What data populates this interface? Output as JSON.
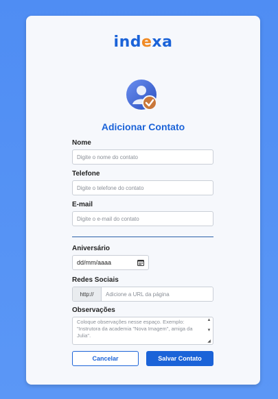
{
  "brand": {
    "logo_part1": "ind",
    "logo_accent": "e",
    "logo_part2": "xa"
  },
  "form": {
    "title": "Adicionar Contato",
    "name": {
      "label": "Nome",
      "placeholder": "Digite o nome do contato"
    },
    "phone": {
      "label": "Telefone",
      "placeholder": "Digite o telefone do contato"
    },
    "email": {
      "label": "E-mail",
      "placeholder": "Digite o e-mail do contato"
    },
    "birthday": {
      "label": "Aniversário",
      "value": "dd/mm/aaaa"
    },
    "social": {
      "label": "Redes Sociais",
      "prefix": "http://",
      "placeholder": "Adicione a URL da página"
    },
    "notes": {
      "label": "Observações",
      "placeholder": "Coloque observações nesse espaço. Exemplo: \"Instrutora da academia \"Nova Imagem\", amiga da Julia\"."
    },
    "cancel_label": "Cancelar",
    "save_label": "Salvar Contato"
  },
  "icons": {
    "avatar": "user-avatar-icon",
    "check": "check-badge-icon",
    "calendar": "calendar-icon"
  },
  "colors": {
    "primary": "#1b63d8",
    "accent": "#f08a24",
    "background": "#4f8df3"
  }
}
